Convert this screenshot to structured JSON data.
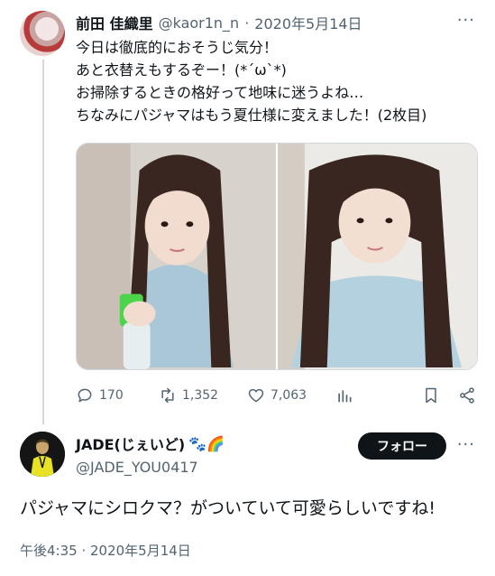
{
  "tweet1": {
    "name": "前田 佳織里",
    "handle": "@kaor1n_n",
    "separator": "·",
    "date": "2020年5月14日",
    "more": "···",
    "lines": [
      "今日は徹底的におそうじ気分！",
      "あと衣替えもするぞー！(*´ω`*)",
      "お掃除するときの格好って地味に迷うよね…",
      "ちなみにパジャマはもう夏仕様に変えました！(2枚目)"
    ],
    "stats": {
      "replies": "170",
      "retweets": "1,352",
      "likes": "7,063"
    }
  },
  "tweet2": {
    "name": "JADE(じぇいど)",
    "name_emoji": "🐾🌈",
    "handle": "@JADE_YOU0417",
    "follow_label": "フォロー",
    "more": "···",
    "text": "パジャマにシロクマ？がついていて可愛らしいですね!",
    "timestamp": "午後4:35 · 2020年5月14日"
  },
  "colors": {
    "text": "#0f1419",
    "muted": "#536471",
    "border": "#cfd9de",
    "button": "#0f1419"
  },
  "icons": [
    "reply-icon",
    "retweet-icon",
    "like-icon",
    "stats-icon",
    "bookmark-icon",
    "share-icon",
    "more-icon"
  ]
}
